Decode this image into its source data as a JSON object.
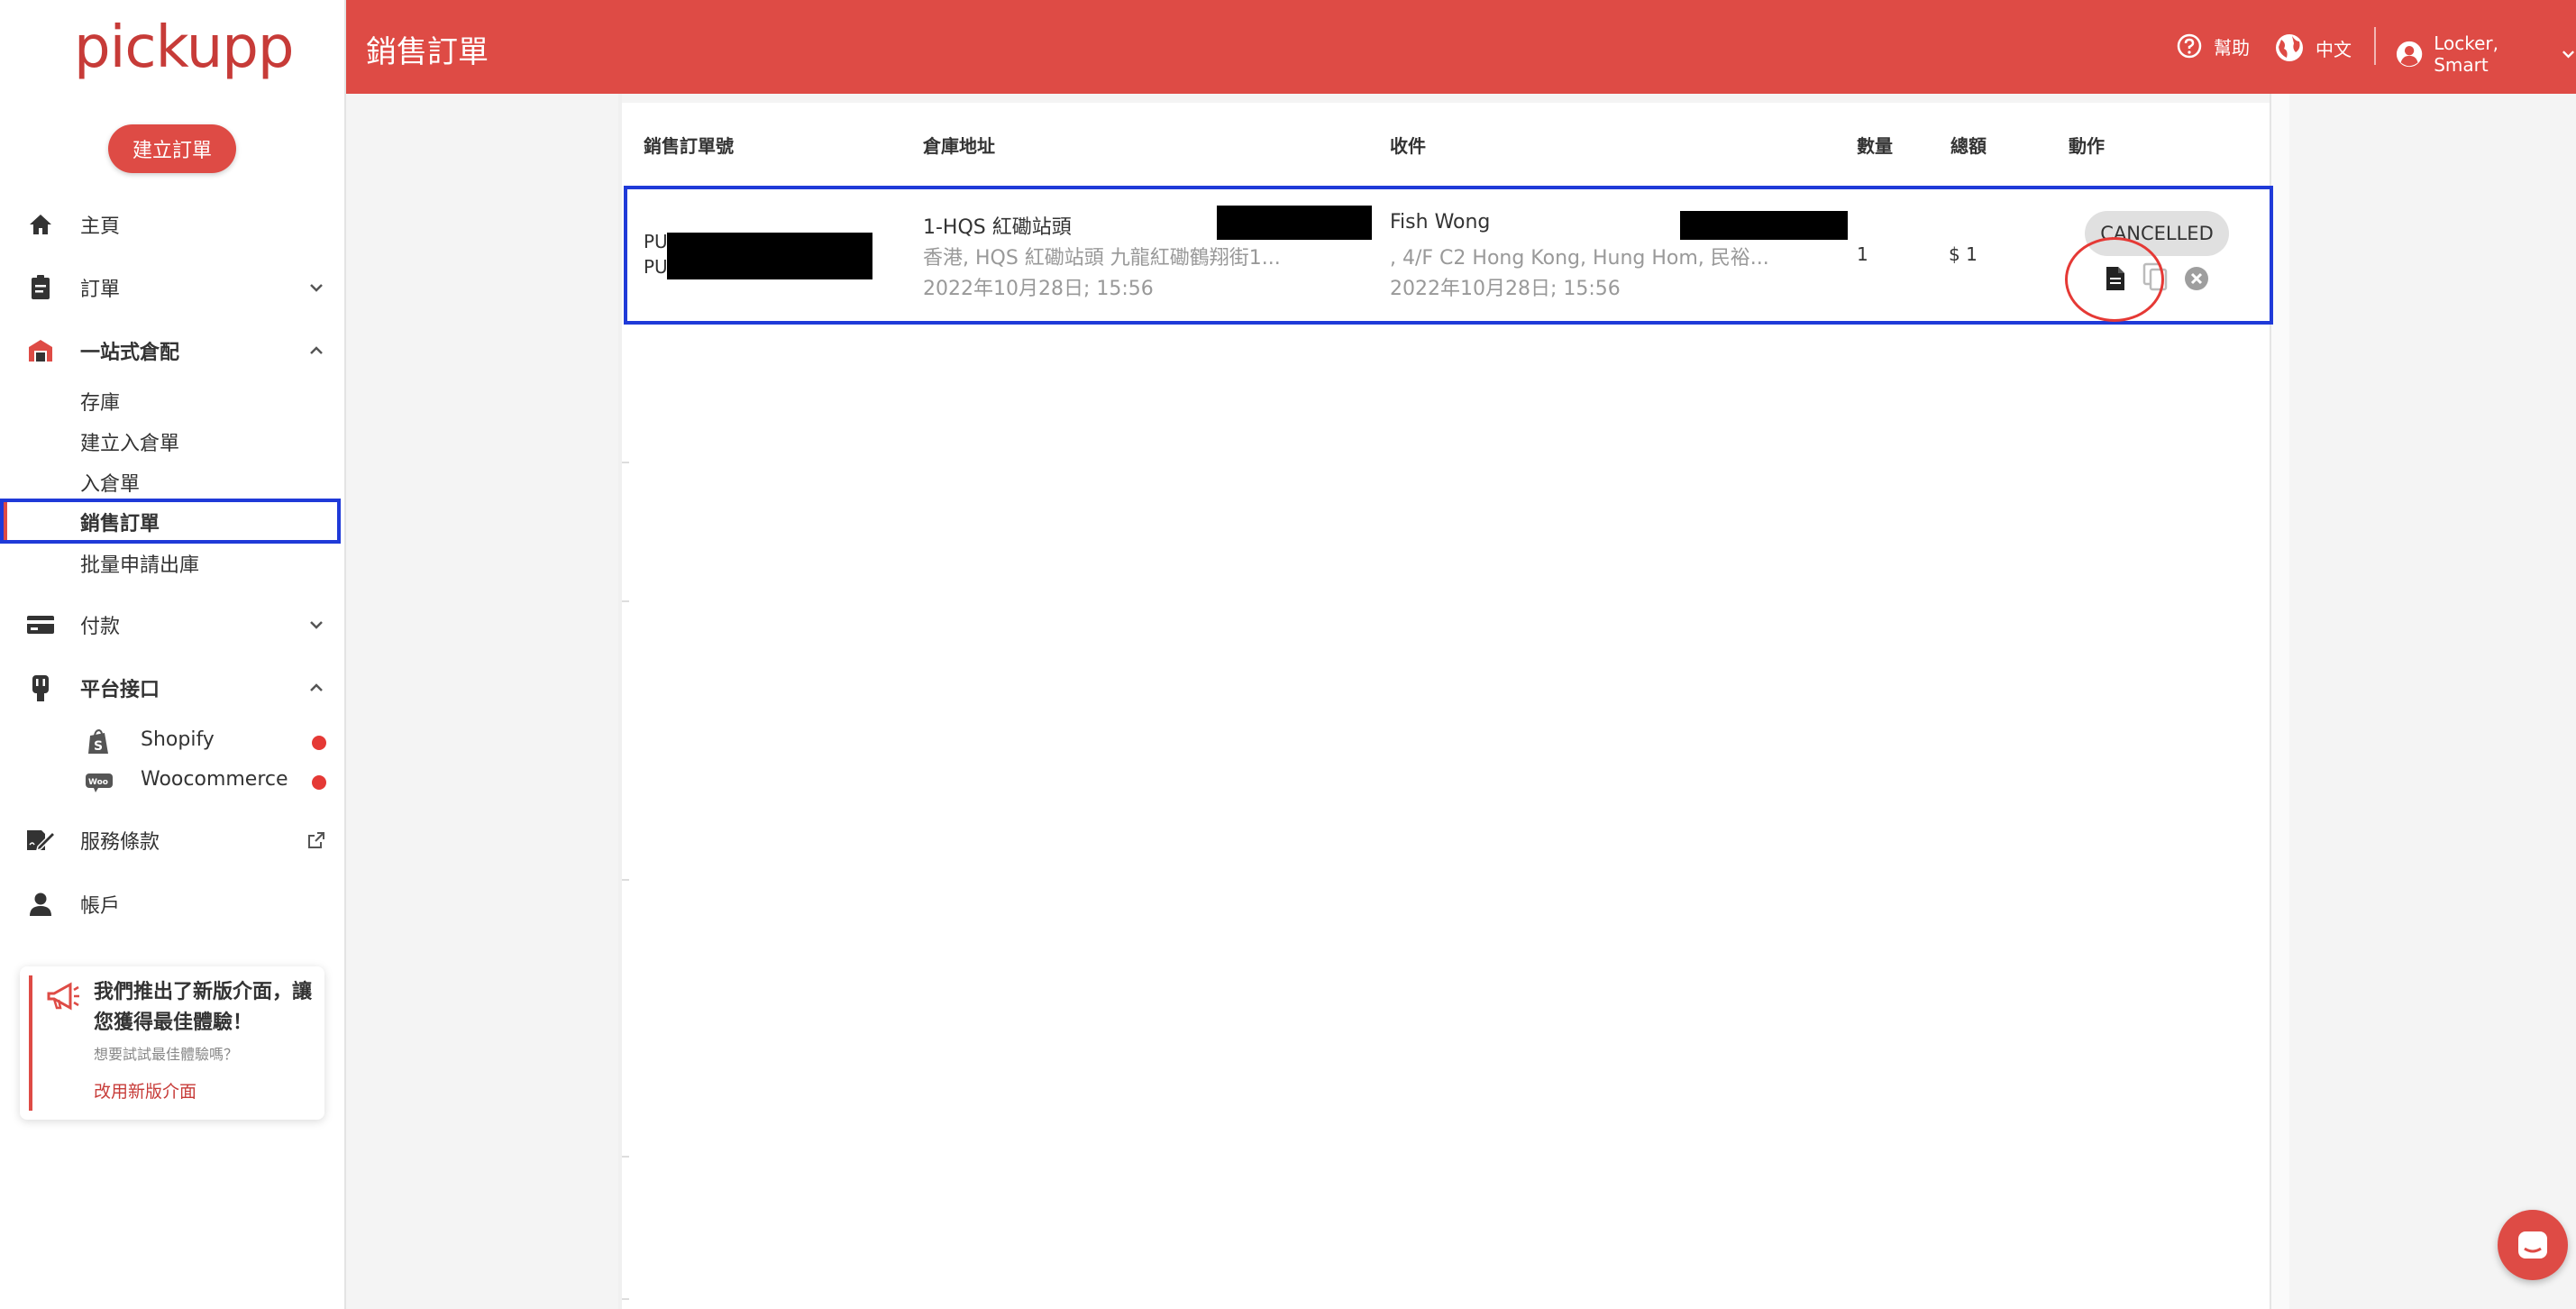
{
  "app": {
    "logo": "pickupp",
    "create_button": "建立訂單"
  },
  "sidebar": {
    "items": [
      {
        "label": "主頁",
        "icon": "home-icon"
      },
      {
        "label": "訂單",
        "icon": "clipboard-icon"
      },
      {
        "label": "一站式倉配",
        "icon": "warehouse-icon"
      },
      {
        "label": "付款",
        "icon": "credit-card-icon"
      },
      {
        "label": "平台接口",
        "icon": "plug-icon"
      },
      {
        "label": "服務條款",
        "icon": "signature-icon"
      },
      {
        "label": "帳戶",
        "icon": "user-icon"
      }
    ],
    "warehouse_sub": [
      "存庫",
      "建立入倉單",
      "入倉單",
      "銷售訂單",
      "批量申請出庫"
    ],
    "active_sub": "銷售訂單",
    "integrations": [
      {
        "label": "Shopify",
        "icon": "shopify-icon"
      },
      {
        "label": "Woocommerce",
        "icon": "woocommerce-icon"
      }
    ]
  },
  "promo": {
    "headline": "我們推出了新版介面，讓您獲得最佳體驗！",
    "subtext": "想要試試最佳體驗嗎？",
    "link": "改用新版介面"
  },
  "header": {
    "title": "銷售訂單",
    "help": "幫助",
    "language": "中文",
    "user": "Locker, Smart"
  },
  "table": {
    "columns": [
      "銷售訂單號",
      "倉庫地址",
      "收件",
      "數量",
      "總額",
      "動作"
    ],
    "rows": [
      {
        "order_no_line1": "PU",
        "order_no_line2": "PU",
        "warehouse_name": "1-HQS 紅磡站頭",
        "warehouse_address": "香港, HQS 紅磡站頭 九龍紅磡鶴翔街1...",
        "warehouse_time": "2022年10月28日; 15:56",
        "recipient_name": "Fish Wong",
        "recipient_address": ", 4/F C2 Hong Kong, Hung Hom, 民裕...",
        "recipient_time": "2022年10月28日; 15:56",
        "quantity": "1",
        "total": "$ 1",
        "status": "CANCELLED"
      }
    ]
  },
  "colors": {
    "brand": "#de4b45",
    "highlight": "#1f3ad8"
  }
}
